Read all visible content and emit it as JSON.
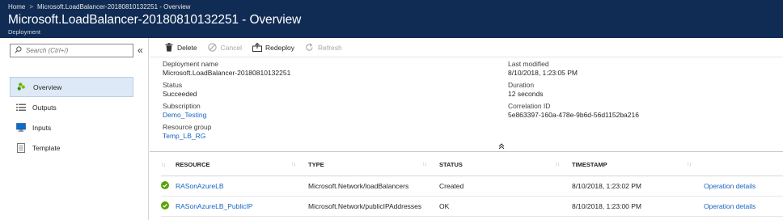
{
  "header": {
    "breadcrumb": [
      "Home",
      "Microsoft.LoadBalancer-20180810132251 - Overview"
    ],
    "title": "Microsoft.LoadBalancer-20180810132251 - Overview",
    "subtitle": "Deployment"
  },
  "sidebar": {
    "search_placeholder": "Search (Ctrl+/)",
    "collapse_glyph": "«",
    "items": [
      {
        "label": "Overview",
        "icon": "overview-icon",
        "active": true
      },
      {
        "label": "Outputs",
        "icon": "outputs-icon"
      },
      {
        "label": "Inputs",
        "icon": "inputs-icon"
      },
      {
        "label": "Template",
        "icon": "template-icon"
      }
    ]
  },
  "toolbar": {
    "delete": "Delete",
    "cancel": "Cancel",
    "redeploy": "Redeploy",
    "refresh": "Refresh"
  },
  "essentials": {
    "deployment_name_label": "Deployment name",
    "deployment_name": "Microsoft.LoadBalancer-20180810132251",
    "status_label": "Status",
    "status": "Succeeded",
    "subscription_label": "Subscription",
    "subscription": "Demo_Testing",
    "resource_group_label": "Resource group",
    "resource_group": "Temp_LB_RG",
    "last_modified_label": "Last modified",
    "last_modified": "8/10/2018, 1:23:05 PM",
    "duration_label": "Duration",
    "duration": "12 seconds",
    "correlation_label": "Correlation ID",
    "correlation": "5e863397-160a-478e-9b6d-56d1152ba216"
  },
  "table": {
    "headers": {
      "resource": "RESOURCE",
      "type": "TYPE",
      "status": "STATUS",
      "timestamp": "TIMESTAMP"
    },
    "rows": [
      {
        "resource": "RASonAzureLB",
        "type": "Microsoft.Network/loadBalancers",
        "status": "Created",
        "timestamp": "8/10/2018, 1:23:02 PM",
        "action": "Operation details"
      },
      {
        "resource": "RASonAzureLB_PublicIP",
        "type": "Microsoft.Network/publicIPAddresses",
        "status": "OK",
        "timestamp": "8/10/2018, 1:23:00 PM",
        "action": "Operation details"
      }
    ]
  },
  "colors": {
    "header_bg": "#102c54",
    "link": "#1664c0",
    "success": "#57a300",
    "active_nav": "#dde9f6"
  }
}
